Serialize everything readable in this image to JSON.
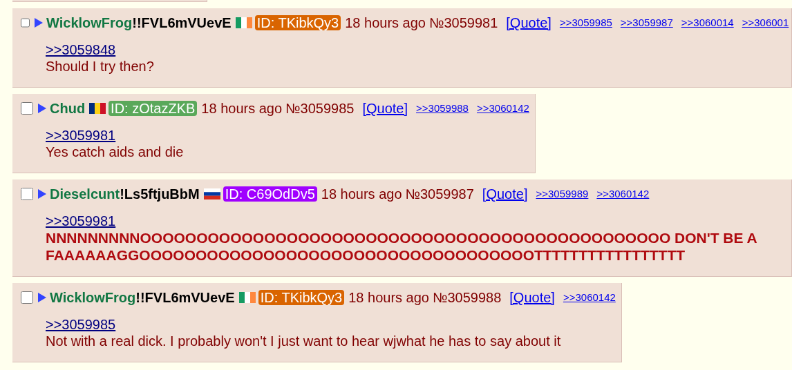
{
  "posts": [
    {
      "checked": false,
      "name": "WicklowFrog",
      "trip": "!!FVL6mVUevE",
      "flag": {
        "kind": "ie"
      },
      "id": {
        "label": "ID: TKibkQy3",
        "color": "#d96400"
      },
      "time": "18 hours ago",
      "number": "№3059981",
      "quote": "[Quote]",
      "backlinks": [
        ">>3059985",
        ">>3059987",
        ">>3060014",
        ">>306001"
      ],
      "reply_to": ">>3059848",
      "body": {
        "kind": "plain",
        "text": "Should I try then?"
      }
    },
    {
      "checked": false,
      "name": "Chud",
      "flag": {
        "kind": "ro"
      },
      "id": {
        "label": "ID: zOtazZKB",
        "color": "#5aa85a"
      },
      "time": "18 hours ago",
      "number": "№3059985",
      "quote": "[Quote]",
      "backlinks": [
        ">>3059988",
        ">>3060142"
      ],
      "reply_to": ">>3059981",
      "body": {
        "kind": "plain",
        "text": "Yes catch aids and die"
      }
    },
    {
      "checked": false,
      "name": "Dieselcunt",
      "trip": "!Ls5ftjuBbM",
      "flag": {
        "kind": "ru"
      },
      "id": {
        "label": "ID: C69OdDv5",
        "color": "#a000ff"
      },
      "time": "18 hours ago",
      "number": "№3059987",
      "quote": "[Quote]",
      "backlinks": [
        ">>3059989",
        ">>3060142"
      ],
      "reply_to": ">>3059981",
      "body": {
        "kind": "shout",
        "text": "NNNNNNNNNOOOOOOOOOOOOOOOOOOOOOOOOOOOOOOOOOOOOOOOOOOOOOOO DON'T BE A FAAAAAAGGOOOOOOOOOOOOOOOOOOOOOOOOOOOOOOOOOOOTTTTTTTTTTTTTTTTT"
      }
    },
    {
      "checked": false,
      "name": "WicklowFrog",
      "trip": "!!FVL6mVUevE",
      "flag": {
        "kind": "ie"
      },
      "id": {
        "label": "ID: TKibkQy3",
        "color": "#d96400"
      },
      "time": "18 hours ago",
      "number": "№3059988",
      "quote": "[Quote]",
      "backlinks": [
        ">>3060142"
      ],
      "reply_to": ">>3059985",
      "body": {
        "kind": "plain",
        "text": "Not with a real dick. I probably won't I just want to hear wjwhat he has to say about it"
      }
    }
  ]
}
